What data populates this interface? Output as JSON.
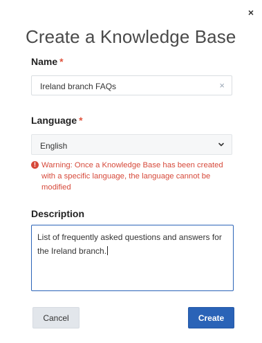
{
  "dialog": {
    "title": "Create a Knowledge Base",
    "close_label": "×"
  },
  "name_field": {
    "label": "Name",
    "required_mark": "*",
    "value": "Ireland branch FAQs",
    "clear_label": "×"
  },
  "language_field": {
    "label": "Language",
    "required_mark": "*",
    "selected": "English"
  },
  "warning": {
    "icon_glyph": "!",
    "text": "Warning: Once a Knowledge Base has been created with a specific language, the language cannot be modified"
  },
  "description_field": {
    "label": "Description",
    "value": "List of frequently asked questions and answers for the Ireland branch."
  },
  "buttons": {
    "cancel": "Cancel",
    "create": "Create"
  },
  "colors": {
    "accent": "#2a63b7",
    "error": "#d6493a",
    "required": "#e0533d"
  }
}
